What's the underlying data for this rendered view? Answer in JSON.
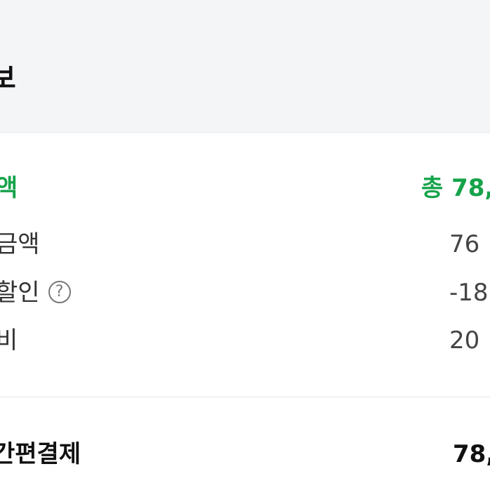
{
  "header": {
    "title": "보"
  },
  "summary": {
    "total": {
      "label": "액",
      "value": "총 78,"
    },
    "rows": [
      {
        "label": "금액",
        "value": "76"
      },
      {
        "label": "할인",
        "value": "-18",
        "help_icon": "?"
      },
      {
        "label": "비",
        "value": "20"
      }
    ]
  },
  "payment": {
    "label": "간편결제",
    "value": "78,"
  },
  "colors": {
    "accent": "#16a34a",
    "header_bg": "#f4f5f7"
  }
}
